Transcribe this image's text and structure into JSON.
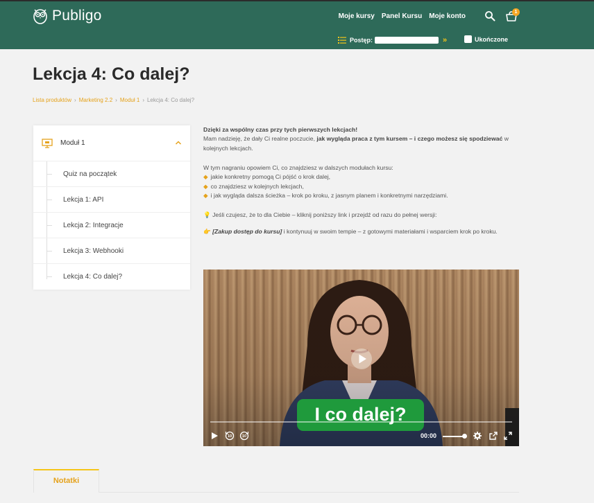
{
  "header": {
    "logo_text": "Publigo",
    "nav": [
      "Moje kursy",
      "Panel Kursu",
      "Moje konto"
    ],
    "cart_count": "1",
    "progress_label": "Postęp:",
    "progress_arrows": "»",
    "completed_label": "Ukończone"
  },
  "page": {
    "title": "Lekcja 4: Co dalej?"
  },
  "breadcrumb": {
    "items": [
      "Lista produktów",
      "Marketing 2.2",
      "Moduł 1"
    ],
    "current": "Lekcja 4: Co dalej?"
  },
  "sidebar": {
    "module_label": "Moduł 1",
    "lessons": [
      "Quiz na początek",
      "Lekcja 1: API",
      "Lekcja 2: Integracje",
      "Lekcja 3: Webhooki",
      "Lekcja 4: Co dalej?"
    ]
  },
  "content": {
    "intro_bold": "Dzięki za wspólny czas przy tych pierwszych lekcjach!",
    "intro_pre": "Mam nadzieję, że dały Ci realne poczucie,",
    "intro_strong": "jak wygląda praca z tym kursem – i czego możesz się spodziewać",
    "intro_post": "w kolejnych lekcjach.",
    "list_intro": "W tym nagraniu opowiem Ci, co znajdziesz w dalszych modułach kursu:",
    "bullets": [
      "jakie konkretny pomogą Ci pójść o krok dalej,",
      "co znajdziesz w kolejnych lekcjach,",
      "i jak wygląda dalsza ścieżka – krok po kroku, z jasnym planem i konkretnymi narzędziami."
    ],
    "tip_icon": "💡",
    "tip_text": "Jeśli czujesz, że to dla Ciebie – kliknij poniższy link i przejdź od razu do pełnej wersji:",
    "cta_icon": "👉",
    "cta_bold": "[Zakup dostęp do kursu]",
    "cta_rest": "i kontynuuj w swoim tempie – z gotowymi materiałami i wsparciem krok po kroku."
  },
  "video": {
    "caption": "I co dalej?",
    "time": "00:00"
  },
  "tabs": {
    "notes": "Notatki"
  },
  "colors": {
    "header_bg": "#2e6a59",
    "accent": "#e5a21b",
    "caption_bg": "#1f9a3c"
  }
}
